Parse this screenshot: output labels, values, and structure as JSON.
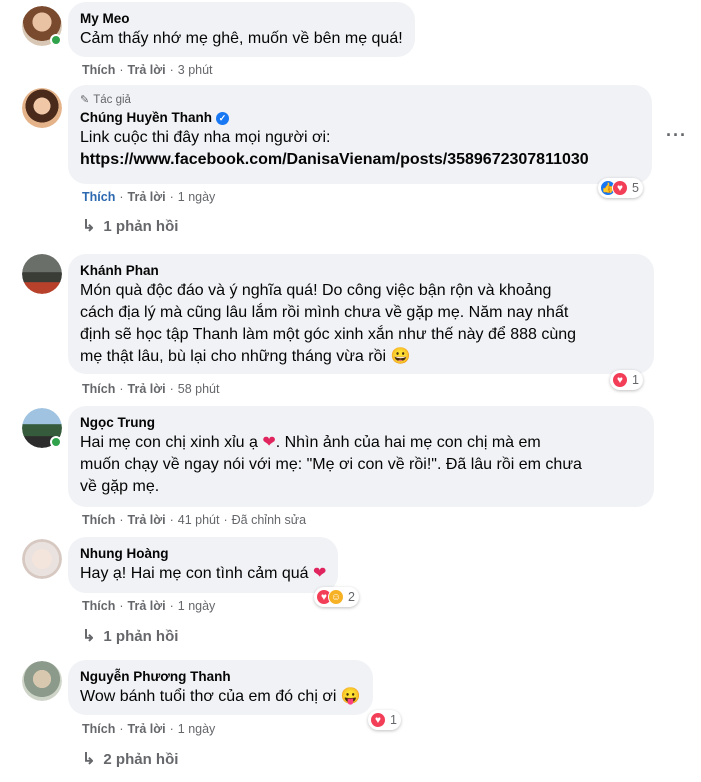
{
  "comments": [
    {
      "author": "My Meo",
      "text": "Cảm thấy nhớ mẹ ghê, muốn về bên mẹ quá!",
      "like": "Thích",
      "reply": "Trả lời",
      "time": "3 phút"
    },
    {
      "badge": "Tác giả",
      "author": "Chúng Huyền Thanh",
      "text1": "Link cuộc thi đây nha mọi người ơi:",
      "text2": "https://www.facebook.com/DanisaVienam/posts/3589672307811030",
      "like": "Thích",
      "reply": "Trả lời",
      "time": "1 ngày",
      "reaction_count": "5",
      "replies": "1 phản hồi"
    },
    {
      "author": "Khánh Phan",
      "lines": [
        "Món quà độc đáo và ý nghĩa quá! Do công việc bận rộn và khoảng",
        "cách địa lý mà cũng lâu lắm rồi mình chưa về gặp mẹ. Năm nay nhất",
        "định sẽ học tập Thanh làm một góc xinh xắn như thế này để 888 cùng",
        "mẹ thật lâu, bù lại cho những tháng vừa rồi"
      ],
      "like": "Thích",
      "reply": "Trả lời",
      "time": "58 phút",
      "reaction_count": "1"
    },
    {
      "author": "Ngọc Trung",
      "lines": [
        "Hai mẹ con chị xinh xỉu ạ",
        ". Nhìn ảnh của hai mẹ con chị mà em",
        "muốn chạy về ngay nói với mẹ: \"Mẹ ơi con về rồi!\". Đã lâu rồi em chưa",
        "về gặp mẹ."
      ],
      "like": "Thích",
      "reply": "Trả lời",
      "time": "41 phút",
      "edited": "Đã chỉnh sửa"
    },
    {
      "author": "Nhung Hoàng",
      "text": "Hay ạ! Hai mẹ con tình cảm quá",
      "like": "Thích",
      "reply": "Trả lời",
      "time": "1 ngày",
      "reaction_count": "2",
      "replies": "1 phản hồi"
    },
    {
      "author": "Nguyễn Phương Thanh",
      "text": "Wow bánh tuổi thơ của em đó chị ơi",
      "like": "Thích",
      "reply": "Trả lời",
      "time": "1 ngày",
      "reaction_count": "1",
      "replies": "2 phản hồi"
    }
  ],
  "colors": {
    "bubble": "#f0f2f5",
    "meta": "#65676b",
    "link_blue": "#1877f2",
    "online": "#31a24c"
  }
}
